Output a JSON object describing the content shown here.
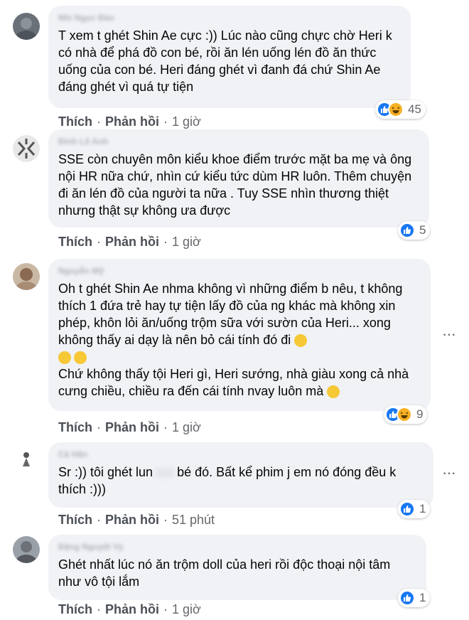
{
  "comments": [
    {
      "author": "Nhi Ngọc Đào",
      "text": "T xem t ghét Shin Ae cực :)) Lúc nào cũng chực chờ Heri k có nhà để phá đồ con bé, rồi ăn lén uống lén đồ ăn thức uống của con bé. Heri đáng ghét vì đanh đá chứ Shin Ae đáng ghét vì quá tự tiện",
      "like_label": "Thích",
      "reply_label": "Phản hồi",
      "time": "1 giờ",
      "reaction_count": "45",
      "reactions": [
        "like",
        "haha"
      ]
    },
    {
      "author": "Đinh Lê Anh",
      "text": "SSE còn chuyên môn kiểu khoe điểm trước mặt ba mẹ và ông nội HR nữa chứ, nhìn cứ kiểu tức dùm HR luôn. Thêm chuyện đi ăn lén đồ của người ta nữa . Tuy SSE nhìn thương thiệt nhưng thật sự không ưa được",
      "like_label": "Thích",
      "reply_label": "Phản hồi",
      "time": "1 giờ",
      "reaction_count": "5",
      "reactions": [
        "like"
      ]
    },
    {
      "author": "Nguyễn Mỹ",
      "text_lines": [
        "Oh t ghét Shin Ae nhma không vì những điểm b nêu, t không thích 1 đứa trẻ hay tự tiện lấy đồ của ng khác mà không xin phép, khôn lỏi ăn/uống trộm sữa với sườn của Heri... xong không thấy ai dạy là nên bỏ cái tính đó đi",
        "Chứ không thấy tội Heri gì, Heri sướng, nhà giàu xong cả nhà cưng chiều, chiều ra đến cái tính nvay luôn mà"
      ],
      "like_label": "Thích",
      "reply_label": "Phản hồi",
      "time": "1 giờ",
      "reaction_count": "9",
      "reactions": [
        "like",
        "haha"
      ],
      "more_icon": "more-dots-icon"
    },
    {
      "author": "Cà Hân",
      "text_start": "Sr :)) tôi ghét lun",
      "text_end": "bé đó. Bất kể phim j em nó đóng đều k thích :)))",
      "like_label": "Thích",
      "reply_label": "Phản hồi",
      "time": "51 phút",
      "reaction_count": "1",
      "reactions": [
        "like"
      ],
      "more_icon": "more-dots-icon"
    },
    {
      "author": "Đặng Nguyệt Vy",
      "text": "Ghét nhất lúc nó ăn trộm doll của heri rồi độc thoại nội tâm như vô tội lắm",
      "like_label": "Thích",
      "reply_label": "Phản hồi",
      "time": "1 giờ",
      "reaction_count": "1",
      "reactions": [
        "like"
      ]
    }
  ],
  "colors": {
    "bubble": "#f0f2f5",
    "like_blue": "#1877f2",
    "haha_yellow": "#f7b125",
    "meta_gray": "#65676b"
  }
}
